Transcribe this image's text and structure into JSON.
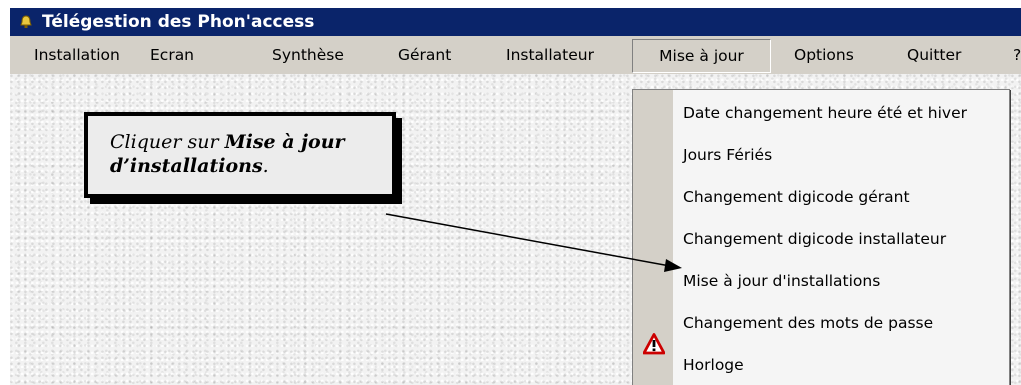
{
  "window": {
    "title": "Télégestion des Phon'access"
  },
  "menubar": {
    "items": [
      {
        "label": "Installation"
      },
      {
        "label": "Ecran"
      },
      {
        "label": "Synthèse"
      },
      {
        "label": "Gérant"
      },
      {
        "label": "Installateur"
      },
      {
        "label": "Mise à jour"
      },
      {
        "label": "Options"
      },
      {
        "label": "Quitter"
      },
      {
        "label": "?"
      }
    ],
    "open_menu": "Mise à jour"
  },
  "dropdown": {
    "items": [
      {
        "label": "Date changement heure été et hiver"
      },
      {
        "label": "Jours Fériés"
      },
      {
        "label": "Changement digicode gérant"
      },
      {
        "label": "Changement digicode installateur"
      },
      {
        "label": "Mise à jour d'installations"
      },
      {
        "label": "Changement des mots de passe",
        "icon": "warning-icon"
      },
      {
        "label": "Horloge"
      }
    ]
  },
  "callout": {
    "prefix": "Cliquer sur ",
    "bold": "Mise à jour d’installations",
    "suffix": "."
  },
  "colors": {
    "titlebar": "#0a246a",
    "menubar": "#d4d0c8",
    "warning": "#cc0000"
  }
}
